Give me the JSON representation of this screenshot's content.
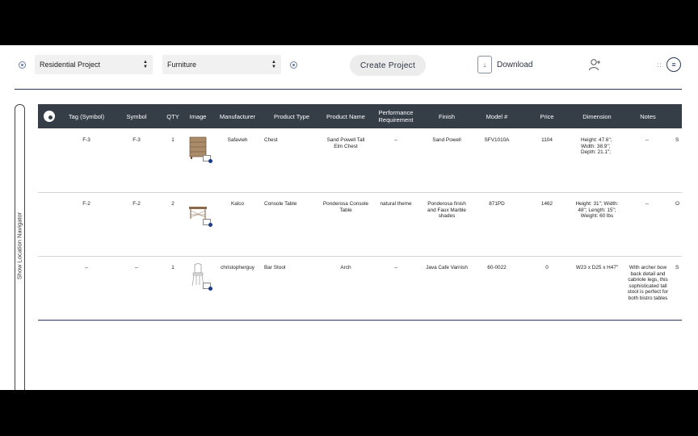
{
  "toolbar": {
    "project_select": "Residential Project",
    "category_select": "Furniture",
    "create_label": "Create Project",
    "download_label": "Download",
    "grid_dots": "::"
  },
  "side_nav": {
    "label": "Show Location Navigator"
  },
  "table": {
    "headers": {
      "tag": "Tag (Symbol)",
      "symbol": "Symbol",
      "qty": "QTY",
      "image": "Image",
      "manufacturer": "Manufacturer",
      "product_type": "Product Type",
      "product_name": "Product Name",
      "performance": "Performance Requirement",
      "finish": "Finish",
      "model": "Model #",
      "price": "Price",
      "dimension": "Dimension",
      "notes": "Notes"
    },
    "rows": [
      {
        "tag": "F-3",
        "symbol": "F-3",
        "qty": "1",
        "manufacturer": "Safavieh",
        "product_type": "Chest",
        "product_name": "Sand Powell Tall Elm Chest",
        "performance": "--",
        "finish": "Sand Powell",
        "model": "SFV1010A",
        "price": "1104",
        "dimension": "Height: 47.6\"; Width: 38.9\"; Depth: 21.1\";",
        "notes": "--",
        "cut": "S"
      },
      {
        "tag": "F-2",
        "symbol": "F-2",
        "qty": "2",
        "manufacturer": "Kalco",
        "product_type": "Console Table",
        "product_name": "Ponderosa Console Table",
        "performance": "natural theme",
        "finish": "Ponderosa finish and Faux Marble shades",
        "model": "871PD",
        "price": "1462",
        "dimension": "Height: 31\"; Width: 48\"; Length: 15\"; Weight: 60 lbs",
        "notes": "--",
        "cut": "O"
      },
      {
        "tag": "--",
        "symbol": "--",
        "qty": "1",
        "manufacturer": "christopherguy",
        "product_type": "Bar Stool",
        "product_name": "Arch",
        "performance": "--",
        "finish": "Java Cafe Varnish",
        "model": "60-0022",
        "price": "0",
        "dimension": "W23 x D25 x H47\"",
        "notes": "With archer bow back detail and cabriole legs, this sophisticated tall stool is perfect for both bistro tables",
        "cut": "S"
      }
    ]
  }
}
